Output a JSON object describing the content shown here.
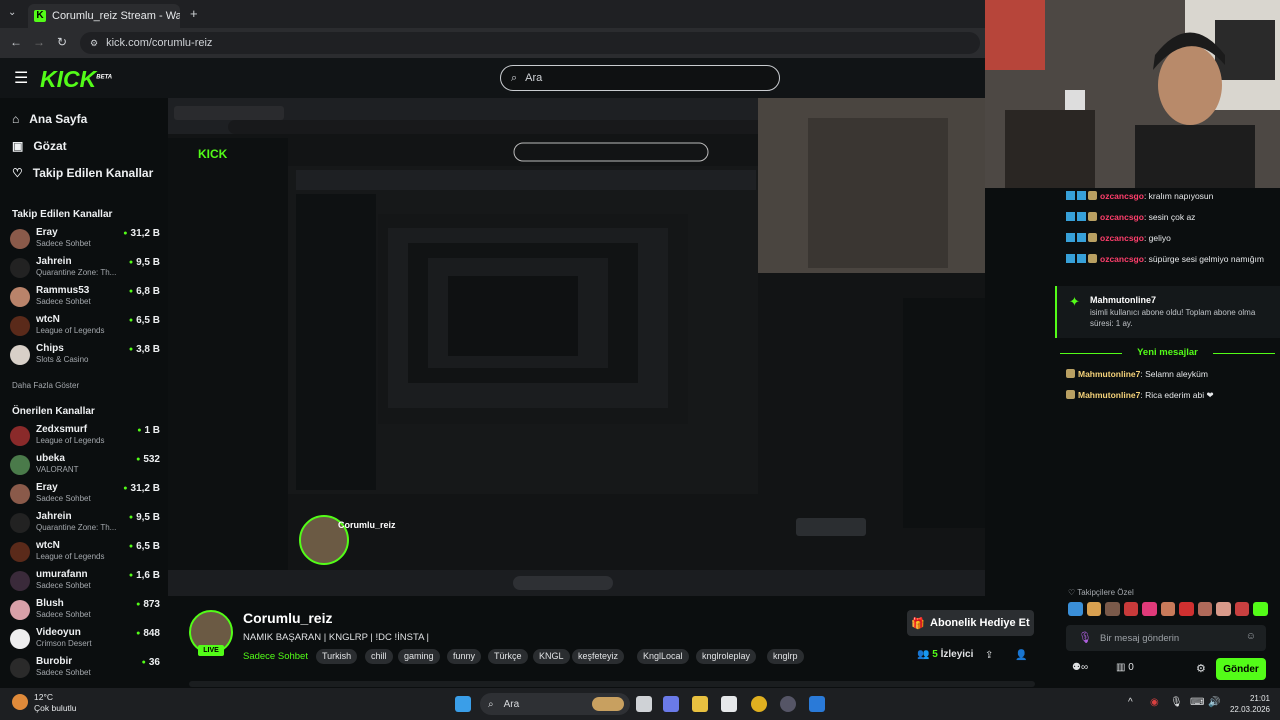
{
  "browser": {
    "tab_title": "Corumlu_reiz Stream - Watch L",
    "url": "kick.com/corumlu-reiz",
    "new_tab_icon": "plus-icon"
  },
  "header": {
    "logo": "KICK",
    "logo_sup": "BETA",
    "search_placeholder": "Ara"
  },
  "nav": [
    {
      "label": "Ana Sayfa",
      "icon": "home-icon"
    },
    {
      "label": "Gözat",
      "icon": "browse-icon"
    },
    {
      "label": "Takip Edilen Kanallar",
      "icon": "heart-icon"
    }
  ],
  "followed": {
    "heading": "Takip Edilen Kanallar",
    "channels": [
      {
        "name": "Eray",
        "category": "Sadece Sohbet",
        "viewers": "31,2 B",
        "color": "#8a5a4a"
      },
      {
        "name": "Jahrein",
        "category": "Quarantine Zone: Th...",
        "viewers": "9,5 B",
        "color": "#222222"
      },
      {
        "name": "Rammus53",
        "category": "Sadece Sohbet",
        "viewers": "6,8 B",
        "color": "#b9836a"
      },
      {
        "name": "wtcN",
        "category": "League of Legends",
        "viewers": "6,5 B",
        "color": "#5a2a1a"
      },
      {
        "name": "Chips",
        "category": "Slots & Casino",
        "viewers": "3,8 B",
        "color": "#d8d0c8"
      }
    ],
    "show_more": "Daha Fazla Göster"
  },
  "recommended": {
    "heading": "Önerilen Kanallar",
    "channels": [
      {
        "name": "Zedxsmurf",
        "category": "League of Legends",
        "viewers": "1 B",
        "color": "#8a2a2a"
      },
      {
        "name": "ubeka",
        "category": "VALORANT",
        "viewers": "532",
        "color": "#4a7a4a"
      },
      {
        "name": "Eray",
        "category": "Sadece Sohbet",
        "viewers": "31,2 B",
        "color": "#8a5a4a"
      },
      {
        "name": "Jahrein",
        "category": "Quarantine Zone: Th...",
        "viewers": "9,5 B",
        "color": "#222222"
      },
      {
        "name": "wtcN",
        "category": "League of Legends",
        "viewers": "6,5 B",
        "color": "#5a2a1a"
      },
      {
        "name": "umurafann",
        "category": "Sadece Sohbet",
        "viewers": "1,6 B",
        "color": "#3a2a3a"
      },
      {
        "name": "Blush",
        "category": "Sadece Sohbet",
        "viewers": "873",
        "color": "#d8a0a8"
      },
      {
        "name": "Videoyun",
        "category": "Crimson Desert",
        "viewers": "848",
        "color": "#eeeeee"
      },
      {
        "name": "Burobir",
        "category": "Sadece Sohbet",
        "viewers": "36",
        "color": "#2a2a2a"
      }
    ]
  },
  "stream": {
    "streamer": "Corumlu_reiz",
    "live_label": "LIVE",
    "title": "NAMIK BAŞARAN | KNGLRP | !DC !İNSTA |",
    "category": "Sadece Sohbet",
    "tags": [
      "Turkish",
      "chill",
      "gaming",
      "funny",
      "Türkçe",
      "KNGL",
      "keşfeteyiz",
      "KnglLocal",
      "knglroleplay",
      "knglrp"
    ],
    "gift_button": "Abonelik Hediye Et",
    "viewers_count": "5",
    "viewers_label": "İzleyici"
  },
  "chat": {
    "messages": [
      {
        "user": "ozcancsgo",
        "text": ": kralım napıyosun"
      },
      {
        "user": "ozcancsgo",
        "text": ": sesin çok az"
      },
      {
        "user": "ozcancsgo",
        "text": ": geliyo"
      },
      {
        "user": "ozcancsgo",
        "text": ": süpürge sesi gelmiyo namığım"
      }
    ],
    "sub_user": "Mahmutonline7",
    "sub_text": "isimli kullanıcı abone oldu! Toplam abone olma süresi: 1 ay.",
    "new_messages": "Yeni mesajlar",
    "new": [
      {
        "user": "Mahmutonline7",
        "text": ": Selamn aleyküm"
      },
      {
        "user": "Mahmutonline7",
        "text": ": Rica ederim abi ❤"
      }
    ],
    "follower_label": "Takipçilere Özel",
    "input_placeholder": "Bir mesaj gönderin",
    "points": "0",
    "send_button": "Gönder"
  },
  "taskbar": {
    "temp": "12°C",
    "weather": "Çok bulutlu",
    "search": "Ara",
    "time": "21:01",
    "date": "22.03.2026"
  }
}
